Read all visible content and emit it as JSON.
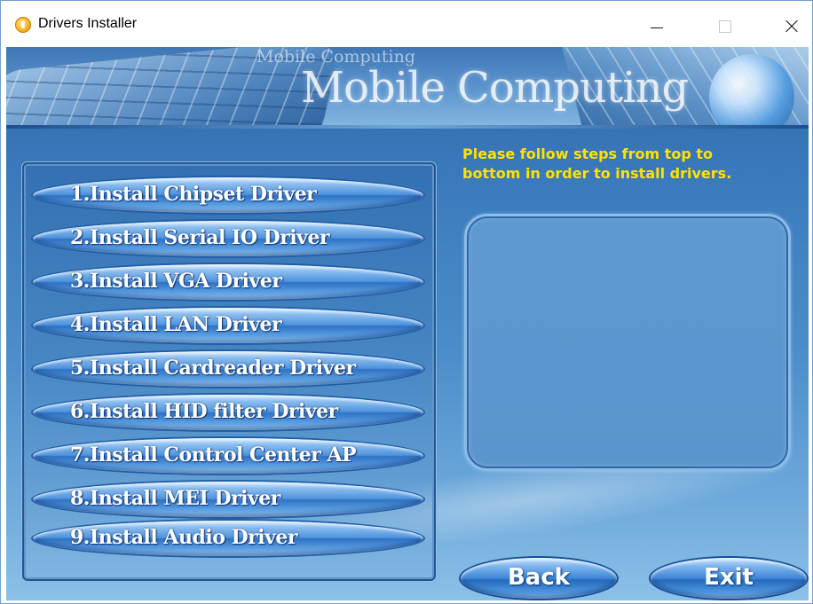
{
  "window": {
    "title": "Drivers Installer"
  },
  "banner": {
    "small_text": "Mobile Computing",
    "big_text": "Mobile Computing"
  },
  "drivers": [
    {
      "label": "1.Install Chipset Driver"
    },
    {
      "label": "2.Install Serial IO  Driver"
    },
    {
      "label": "3.Install VGA Driver"
    },
    {
      "label": "4.Install LAN Driver"
    },
    {
      "label": "5.Install Cardreader Driver"
    },
    {
      "label": "6.Install HID filter Driver"
    },
    {
      "label": "7.Install Control Center AP"
    },
    {
      "label": "8.Install MEI Driver"
    },
    {
      "label": "9.Install Audio Driver"
    }
  ],
  "instructions": {
    "line1": "Please follow steps from top to",
    "line2": "bottom in order to install drivers."
  },
  "actions": {
    "back_label": "Back",
    "exit_label": "Exit"
  },
  "colors": {
    "instruction_text": "#ffe300",
    "button_blue": "#2f72c4",
    "background_blue": "#3b7bbd"
  },
  "icons": {
    "app": "driver-disc-icon",
    "minimize": "minimize-icon",
    "maximize": "maximize-icon",
    "close": "close-icon"
  }
}
